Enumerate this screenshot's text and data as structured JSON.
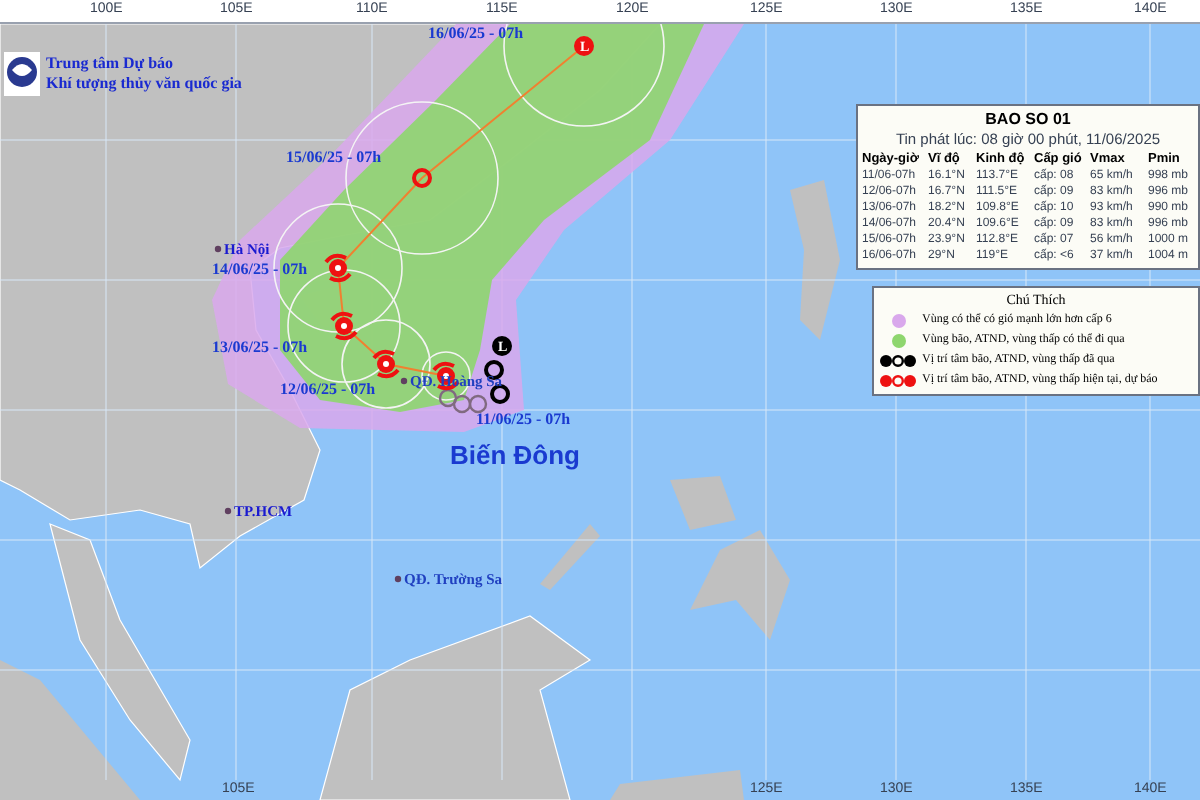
{
  "agency": {
    "lines": [
      "Trung tâm Dự báo",
      "Khí tượng thủy văn quốc gia"
    ]
  },
  "axis_top": [
    "100E",
    "105E",
    "110E",
    "115E",
    "120E",
    "125E",
    "130E",
    "135E",
    "140E"
  ],
  "axis_bottom": [
    "105E",
    "125E",
    "130E",
    "135E",
    "140E"
  ],
  "places": [
    {
      "kind": "city",
      "name": "Hà Nội"
    },
    {
      "kind": "island",
      "name": "QĐ. Hoàng Sa"
    },
    {
      "kind": "city",
      "name": "TP.HCM"
    },
    {
      "kind": "island",
      "name": "QĐ. Trường Sa"
    },
    {
      "kind": "sea",
      "name": "Biến Đông"
    }
  ],
  "past_positions": [
    {
      "kind": "low",
      "letter": "L"
    },
    {
      "kind": "depression"
    },
    {
      "kind": "depression"
    },
    {
      "kind": "faded"
    },
    {
      "kind": "faded"
    },
    {
      "kind": "faded"
    }
  ],
  "track": [
    {
      "kind": "storm",
      "label": "11/06/25 - 07h"
    },
    {
      "kind": "storm",
      "label": "12/06/25 - 07h"
    },
    {
      "kind": "storm",
      "label": "13/06/25 - 07h"
    },
    {
      "kind": "storm",
      "label": "14/06/25 - 07h"
    },
    {
      "kind": "depression",
      "label": "15/06/25 - 07h"
    },
    {
      "kind": "low",
      "letter": "L",
      "label": "16/06/25 - 07h"
    }
  ],
  "info_panel": {
    "title": "BAO SO 01",
    "subtitle": "Tin phát lúc: 08 giờ 00 phút, 11/06/2025",
    "columns": [
      "Ngày-giờ",
      "Vĩ độ",
      "Kinh độ",
      "Cấp gió",
      "Vmax",
      "Pmin"
    ],
    "rows": [
      [
        "11/06-07h",
        "16.1°N",
        "113.7°E",
        "cấp: 08",
        "65 km/h",
        "998 mb"
      ],
      [
        "12/06-07h",
        "16.7°N",
        "111.5°E",
        "cấp: 09",
        "83 km/h",
        "996 mb"
      ],
      [
        "13/06-07h",
        "18.2°N",
        "109.8°E",
        "cấp: 10",
        "93 km/h",
        "990 mb"
      ],
      [
        "14/06-07h",
        "20.4°N",
        "109.6°E",
        "cấp: 09",
        "83 km/h",
        "996 mb"
      ],
      [
        "15/06-07h",
        "23.9°N",
        "112.8°E",
        "cấp: 07",
        "56 km/h",
        "1000 m"
      ],
      [
        "16/06-07h",
        "29°N",
        "119°E",
        "cấp: <6",
        "37 km/h",
        "1004 m"
      ]
    ]
  },
  "legend": {
    "title": "Chú Thích",
    "items": [
      {
        "kind": "area",
        "color": "#d9a8ec",
        "text": "Vùng có thể có gió mạnh lớn hơn cấp 6"
      },
      {
        "kind": "area",
        "color": "#8ed66e",
        "text": "Vùng bão, ATND, vùng thấp có thể đi qua"
      },
      {
        "kind": "symbols",
        "color": "#000000",
        "text": "Vị trí tâm bão, ATND, vùng thấp đã qua"
      },
      {
        "kind": "symbols",
        "color": "#ee1111",
        "text": "Vị trí tâm bão, ATND, vùng thấp hiện tại, dự báo"
      }
    ]
  }
}
